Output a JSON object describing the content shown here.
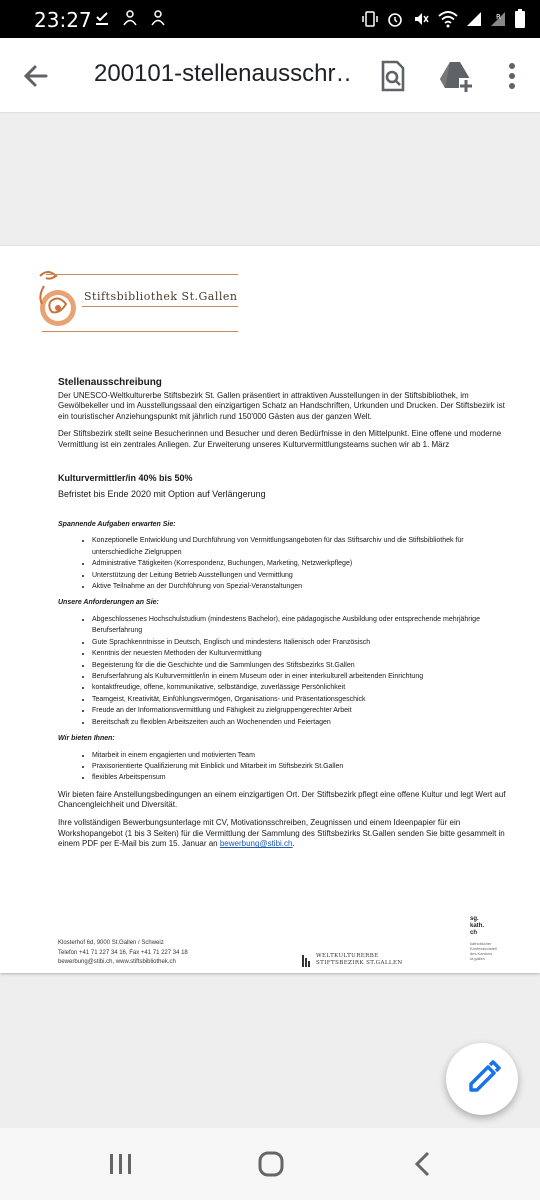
{
  "status_bar": {
    "time": "23:27",
    "left_icons": [
      "check-download-icon",
      "person-icon",
      "person-icon"
    ],
    "right_icons": [
      "vibrate-icon",
      "alarm-icon",
      "mute-icon",
      "wifi-icon",
      "signal-icon",
      "roaming-signal-icon",
      "battery-icon"
    ]
  },
  "app_bar": {
    "title": "200101-stellenausschr…",
    "icons": [
      "back-arrow-icon",
      "search-document-icon",
      "add-to-drive-icon",
      "more-vert-icon"
    ]
  },
  "document": {
    "logo": {
      "text": "Stiftsbibliothek St.Gallen",
      "brand_color": "#c9723a"
    },
    "heading": "Stellenausschreibung",
    "intro_paragraphs": [
      "Der UNESCO-Weltkulturerbe Stiftsbezirk St. Gallen präsentiert in attraktiven Ausstellungen in der Stiftsbibliothek, im Gewölbekeller und im Ausstellungssaal den einzigartigen Schatz an Handschriften, Urkunden und Drucken. Der Stiftsbezirk ist ein touristischer Anziehungspunkt mit jährlich rund 150'000 Gästen aus der ganzen Welt.",
      "Der Stiftsbezirk stellt seine Besucherinnen und Besucher und deren Bedürfnisse in den Mittelpunkt. Eine offene und moderne Vermittlung ist ein zentrales Anliegen. Zur Erweiterung unseres Kulturvermittlungsteams suchen wir ab 1. März"
    ],
    "job_title": "Kulturvermittler/in 40% bis 50%",
    "job_subtitle": "Befristet bis Ende 2020 mit Option auf Verlängerung",
    "sections": [
      {
        "heading": "Spannende Aufgaben erwarten Sie:",
        "items": [
          "Konzeptionelle Entwicklung und Durchführung von Vermittlungsangeboten für das Stiftsarchiv und die Stiftsbibliothek für unterschiedliche Zielgruppen",
          "Administrative Tätigkeiten (Korrespondenz, Buchungen, Marketing, Netzwerkpflege)",
          "Unterstützung der Leitung Betrieb Ausstellungen und Vermittlung",
          "Aktive Teilnahme an der Durchführung von Spezial-Veranstaltungen"
        ]
      },
      {
        "heading": "Unsere Anforderungen an Sie:",
        "items": [
          "Abgeschlossenes Hochschulstudium (mindestens Bachelor), eine pädagogische Ausbildung oder entsprechende mehrjährige Berufserfahrung",
          "Gute Sprachkenntnisse in Deutsch, Englisch und mindestens Italienisch oder Französisch",
          "Kenntnis der neuesten Methoden der Kulturvermittlung",
          "Begeisterung für die die Geschichte und die Sammlungen des Stiftsbezirks St.Gallen",
          "Berufserfahrung als Kulturvermittler/in in einem Museum oder in einer interkulturell arbeitenden Einrichtung",
          "kontaktfreudige, offene, kommunikative, selbständige, zuverlässige Persönlichkeit",
          "Teamgeist, Kreativität, Einfühlungsvermögen, Organisations- und Präsentationsgeschick",
          "Freude an der Informationsvermittlung und Fähigkeit zu zielgruppengerechter Arbeit",
          "Bereitschaft zu flexiblen Arbeitszeiten auch an Wochenenden und Feiertagen"
        ]
      },
      {
        "heading": "Wir bieten Ihnen:",
        "items": [
          "Mitarbeit in einem engagierten und motivierten Team",
          "Praxisorientierte Qualifizierung mit Einblick und Mitarbeit im Stiftsbezirk St.Gallen",
          "flexibles Arbeitspensum"
        ]
      }
    ],
    "closing_paragraph": "Wir bieten faire Anstellungsbedingungen an einem einzigartigen Ort. Der Stiftsbezirk pflegt eine offene Kultur und legt Wert auf Chancengleichheit und Diversität.",
    "application_text": "Ihre vollständigen Bewerbungsunterlage mit CV, Motivationsschreiben, Zeugnissen und einem Ideenpapier für ein Workshopangebot (1 bis 3 Seiten) für die Vermittlung der Sammlung des Stiftsbezirks St.Gallen senden Sie bitte gesammelt in einem PDF per E-Mail bis zum 15. Januar an",
    "application_email": "bewerbung@stibi.ch",
    "application_end": ".",
    "footer": {
      "address": "Klosterhof 6d, 9000 St.Gallen / Schweiz",
      "phone": "Telefon +41 71 227 34 16, Fax +41 71 227 34 18",
      "web": "bewerbung@stibi.ch, www.stiftsbibliothek.ch",
      "heritage_line1": "Weltkulturerbe",
      "heritage_line2": "Stiftsbezirk St.Gallen",
      "sg_logo": [
        "sg.",
        "kath.",
        "ch"
      ],
      "sg_sub": [
        "katholischer",
        "Konfessionsteil",
        "des Kantons",
        "st.gallen"
      ]
    }
  },
  "fab": {
    "icon": "edit-pencil-icon",
    "color": "#1a73e8"
  },
  "nav_bar": {
    "icons": [
      "recent-apps-icon",
      "home-icon",
      "back-icon"
    ]
  }
}
